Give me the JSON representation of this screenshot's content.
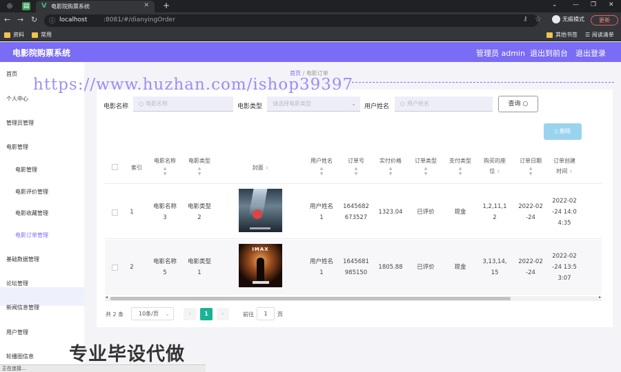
{
  "browser": {
    "tab_title": "电影院购票系统",
    "url_host": "localhost",
    "url_path": ":8081/#/dianyingOrder",
    "incognito_label": "无痕模式",
    "update_label": "更新",
    "bookmarks": [
      "资料",
      "常用"
    ],
    "bookmarks_right": [
      "其他书签",
      "阅读清单"
    ]
  },
  "header": {
    "title": "电影院购票系统",
    "admin": "管理员 admin",
    "to_front": "退出到前台",
    "logout": "退出登录"
  },
  "sidebar": {
    "items": [
      "首页",
      "个人中心",
      "管理员管理",
      "电影管理"
    ],
    "sub_items": [
      "电影管理",
      "电影评价管理",
      "电影收藏管理",
      "电影订单管理"
    ],
    "items_after": [
      "基础数据管理",
      "论坛管理",
      "新闻信息管理",
      "用户管理",
      "轮播图信息"
    ]
  },
  "breadcrumb": {
    "home": "首页",
    "current": "电影订单"
  },
  "watermark": "https://www.huzhan.com/ishop39397",
  "filters": {
    "name_label": "电影名称",
    "name_placeholder": "电影名称",
    "type_label": "电影类型",
    "type_placeholder": "请选择电影类型",
    "user_label": "用户姓名",
    "user_placeholder": "用户姓名",
    "query": "查询",
    "delete": "删除"
  },
  "table": {
    "headers": {
      "index": "索引",
      "name": [
        "电影名称"
      ],
      "type": [
        "电影类型"
      ],
      "cover": "封面",
      "user": [
        "用户姓名"
      ],
      "order_no": [
        "订单号"
      ],
      "price": [
        "实付价格"
      ],
      "order_type": [
        "订单类型"
      ],
      "pay_type": [
        "支付类型"
      ],
      "seats": [
        "购买的座",
        "位"
      ],
      "date": [
        "订单日期"
      ],
      "created": [
        "订单创建",
        "时间"
      ]
    },
    "rows": [
      {
        "index": "1",
        "name": [
          "电影名称",
          "3"
        ],
        "type": [
          "电影类型",
          "2"
        ],
        "cover": "poster-1",
        "user": [
          "用户姓名",
          "1"
        ],
        "order_no": [
          "1645682",
          "673527"
        ],
        "price": "1323.04",
        "order_type": "已评价",
        "pay_type": "现金",
        "seats": [
          "1,2,11,1",
          "2"
        ],
        "date": [
          "2022-02",
          "-24"
        ],
        "created": [
          "2022-02",
          "-24 14:0",
          "4:35"
        ]
      },
      {
        "index": "2",
        "name": [
          "电影名称",
          "5"
        ],
        "type": [
          "电影类型",
          "1"
        ],
        "cover": "poster-2",
        "user": [
          "用户姓名",
          "1"
        ],
        "order_no": [
          "1645681",
          "985150"
        ],
        "price": "1805.88",
        "order_type": "已评价",
        "pay_type": "现金",
        "seats": [
          "3,13,14,",
          "15"
        ],
        "date": [
          "2022-02",
          "-24"
        ],
        "created": [
          "2022-02",
          "-24 13:5",
          "3:07"
        ]
      }
    ]
  },
  "pagination": {
    "total": "共 2 条",
    "page_size": "10条/页",
    "current": "1",
    "goto_label": "前往",
    "goto_value": "1",
    "page_unit": "页"
  },
  "promo_text": "专业毕设代做",
  "status_text": "正在连接...",
  "colors": {
    "accent": "#7a6cf4",
    "success": "#1ab394",
    "danger_btn": "#9ad3ee"
  }
}
